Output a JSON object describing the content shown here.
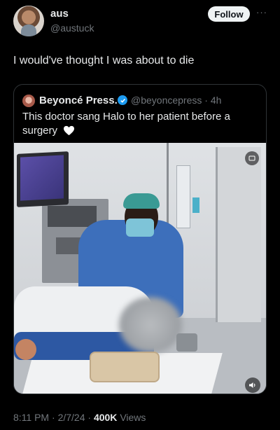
{
  "tweet": {
    "author_name": "aus",
    "author_handle": "@austuck",
    "follow_label": "Follow",
    "text": "I would've thought I was about to die",
    "time": "8:11 PM",
    "sep1": "·",
    "date": "2/7/24",
    "sep2": "·",
    "views_count": "400K",
    "views_label": "Views"
  },
  "quoted": {
    "author_name": "Beyoncé Press.",
    "author_handle": "@beyoncepress",
    "age": "· 4h",
    "text": "This doctor sang Halo to her patient before a surgery"
  },
  "icons": {
    "more": "more-horizontal-icon",
    "verified": "verified-badge-icon",
    "heart": "white-heart-emoji",
    "volume": "volume-icon",
    "badge": "video-badge-icon"
  },
  "colors": {
    "background": "#000000",
    "text": "#e7e9ea",
    "muted": "#71767b",
    "verified": "#1d9bf0",
    "follow_bg": "#eff3f4"
  }
}
